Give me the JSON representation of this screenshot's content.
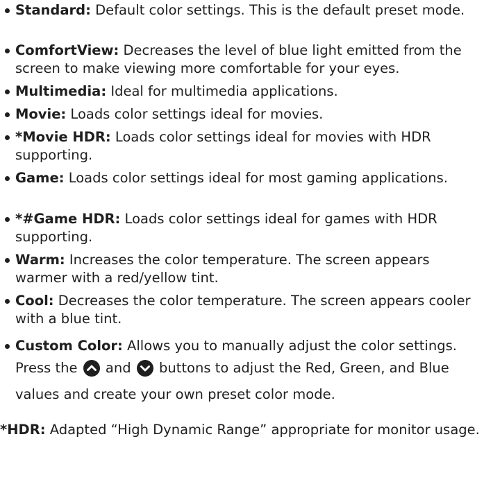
{
  "presets": [
    {
      "term": "Standard:",
      "text": " Default color settings. This is the default preset mode."
    },
    {
      "term": "ComfortView:",
      "text": " Decreases the level of blue light emitted from the screen to make viewing more comfortable for your eyes."
    },
    {
      "term": "Multimedia:",
      "text": " Ideal for multimedia applications."
    },
    {
      "term": "Movie:",
      "text": " Loads color settings ideal for movies."
    },
    {
      "term": "*Movie HDR:",
      "text": " Loads color settings ideal for movies with HDR supporting."
    },
    {
      "term": "Game:",
      "text": " Loads color settings ideal for most gaming applications."
    },
    {
      "term": "*#Game HDR:",
      "text": " Loads color settings ideal for games with HDR supporting."
    },
    {
      "term": "Warm:",
      "text": " Increases the color temperature. The screen appears warmer with a red/yellow tint."
    },
    {
      "term": "Cool:",
      "text": " Decreases the color temperature. The screen appears cooler with a blue tint."
    }
  ],
  "custom_color": {
    "term": "Custom Color:",
    "text_before": " Allows you to manually adjust the color settings. Press the ",
    "text_middle": " and ",
    "text_after": " buttons to adjust the Red, Green, and Blue values and create your own preset color mode.",
    "icon_up": "chevron-up-circle-icon",
    "icon_down": "chevron-down-circle-icon"
  },
  "footnote": {
    "term": "*HDR:",
    "text": " Adapted “High Dynamic Range” appropriate for monitor usage."
  },
  "colors": {
    "text": "#1f1f1f",
    "icon_fill": "#1f1f1f"
  }
}
